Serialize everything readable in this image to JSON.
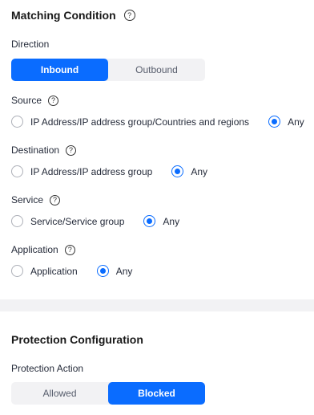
{
  "matching": {
    "title": "Matching Condition",
    "direction": {
      "label": "Direction",
      "options": [
        "Inbound",
        "Outbound"
      ],
      "selected": "Inbound"
    },
    "source": {
      "label": "Source",
      "options": [
        "IP Address/IP address group/Countries and regions",
        "Any"
      ],
      "selected": "Any"
    },
    "destination": {
      "label": "Destination",
      "options": [
        "IP Address/IP address group",
        "Any"
      ],
      "selected": "Any"
    },
    "service": {
      "label": "Service",
      "options": [
        "Service/Service group",
        "Any"
      ],
      "selected": "Any"
    },
    "application": {
      "label": "Application",
      "options": [
        "Application",
        "Any"
      ],
      "selected": "Any"
    }
  },
  "protection": {
    "title": "Protection Configuration",
    "action": {
      "label": "Protection Action",
      "options": [
        "Allowed",
        "Blocked"
      ],
      "selected": "Blocked"
    }
  },
  "help_glyph": "?",
  "colors": {
    "accent": "#0a6cff",
    "segment_bg": "#f2f2f4",
    "divider": "#f2f2f4"
  }
}
